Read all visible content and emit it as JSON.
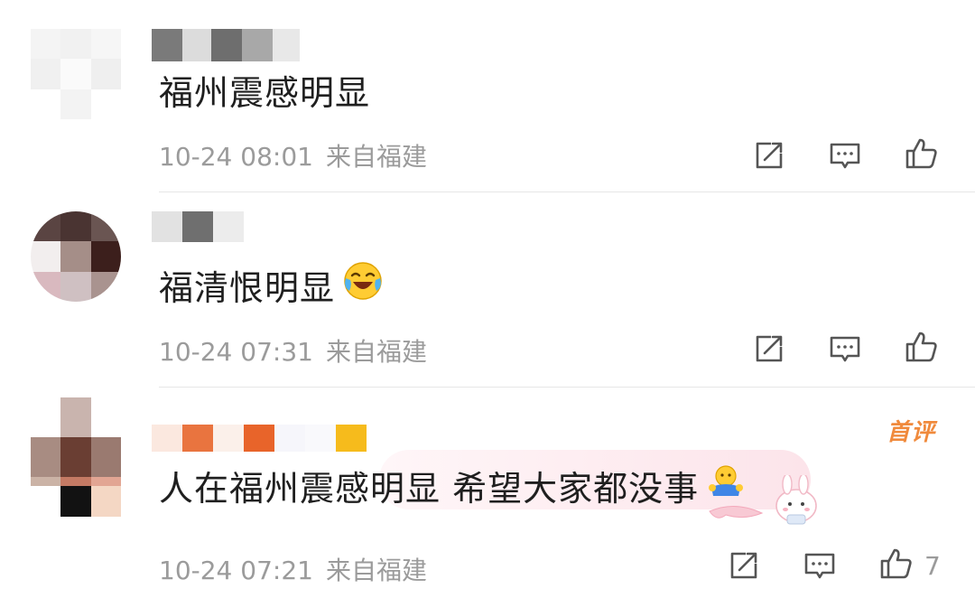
{
  "comments": [
    {
      "text": "福州震感明显",
      "time": "10-24 08:01",
      "source": "来自福建",
      "likes": ""
    },
    {
      "text": "福清恨明显",
      "time": "10-24 07:31",
      "source": "来自福建",
      "likes": ""
    },
    {
      "text": "人在福州震感明显 希望大家都没事",
      "time": "10-24 07:21",
      "source": "来自福建",
      "badge": "首评",
      "likes": "7"
    }
  ],
  "icons": {
    "share": "share-icon",
    "comment": "comment-icon",
    "like": "like-icon"
  },
  "colors": {
    "text": "#1f1f1f",
    "meta": "#9b9b9b",
    "divider": "#e6e6e6",
    "badge": "#f08a3c"
  }
}
